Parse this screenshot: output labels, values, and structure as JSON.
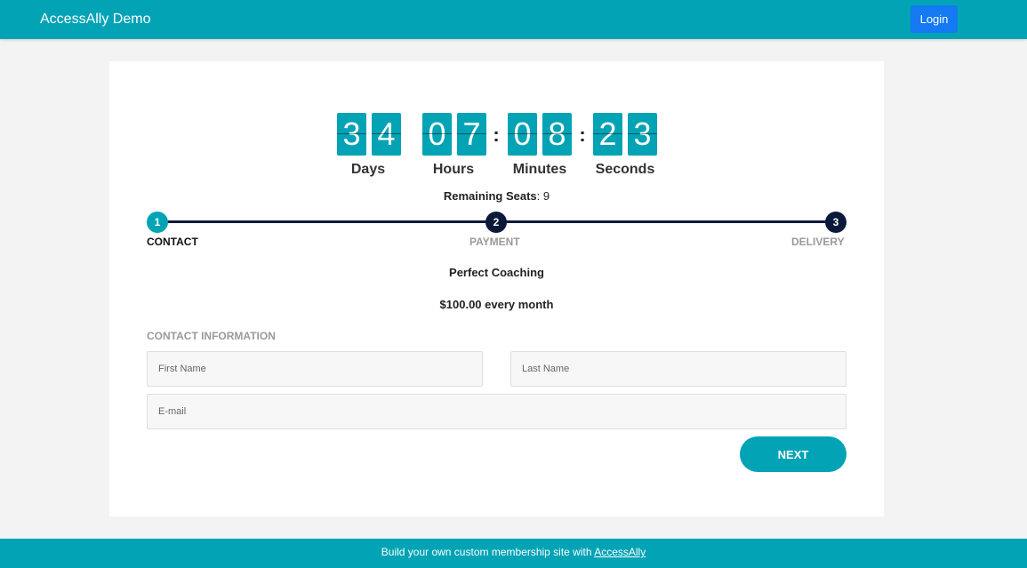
{
  "header": {
    "brand": "AccessAlly Demo",
    "login_label": "Login"
  },
  "countdown": {
    "days": [
      "3",
      "4"
    ],
    "hours": [
      "0",
      "7"
    ],
    "minutes": [
      "0",
      "8"
    ],
    "seconds": [
      "2",
      "3"
    ],
    "separator": ":",
    "labels": {
      "days": "Days",
      "hours": "Hours",
      "minutes": "Minutes",
      "seconds": "Seconds"
    }
  },
  "seats": {
    "label": "Remaining Seats",
    "value": ": 9"
  },
  "steps": [
    {
      "number": "1",
      "label": "CONTACT",
      "active": true
    },
    {
      "number": "2",
      "label": "PAYMENT",
      "active": false
    },
    {
      "number": "3",
      "label": "DELIVERY",
      "active": false
    }
  ],
  "product": {
    "name": "Perfect Coaching",
    "price": "$100.00 every month"
  },
  "form": {
    "section_title": "CONTACT INFORMATION",
    "first_name_placeholder": "First Name",
    "last_name_placeholder": "Last Name",
    "email_placeholder": "E-mail",
    "next_label": "NEXT"
  },
  "footer": {
    "text": "Build your own custom membership site with ",
    "link_label": "AccessAlly"
  },
  "colors": {
    "accent": "#02a3b4",
    "login": "#1479f2",
    "step_dark": "#0b1a3b",
    "muted": "#9a9a9a"
  }
}
